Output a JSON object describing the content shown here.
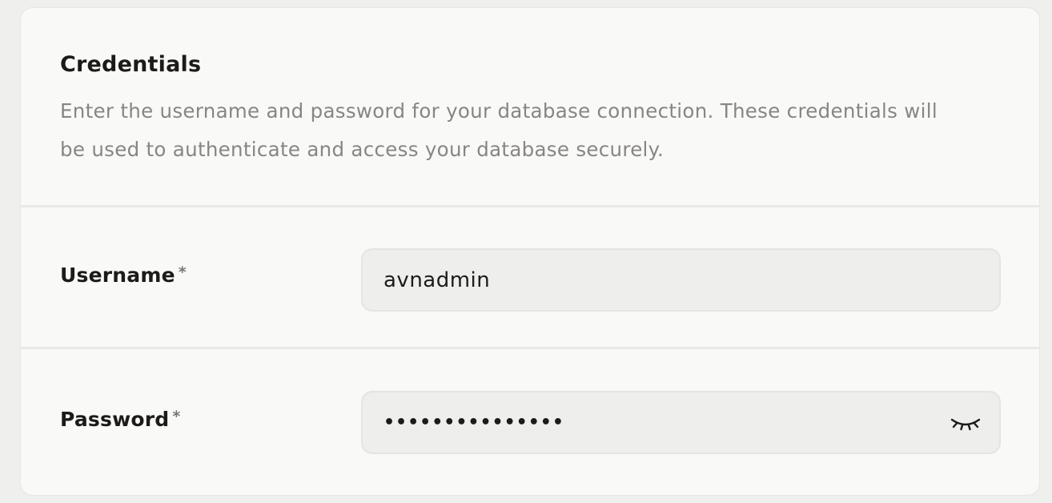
{
  "section": {
    "title": "Credentials",
    "description": "Enter the username and password for your database connection. These credentials will be used to authenticate and access your database securely."
  },
  "fields": {
    "username": {
      "label": "Username",
      "required_marker": "*",
      "value": "avnadmin"
    },
    "password": {
      "label": "Password",
      "required_marker": "*",
      "masked_value": "•••••••••••••••",
      "toggle_icon": "eye-closed-icon"
    }
  }
}
